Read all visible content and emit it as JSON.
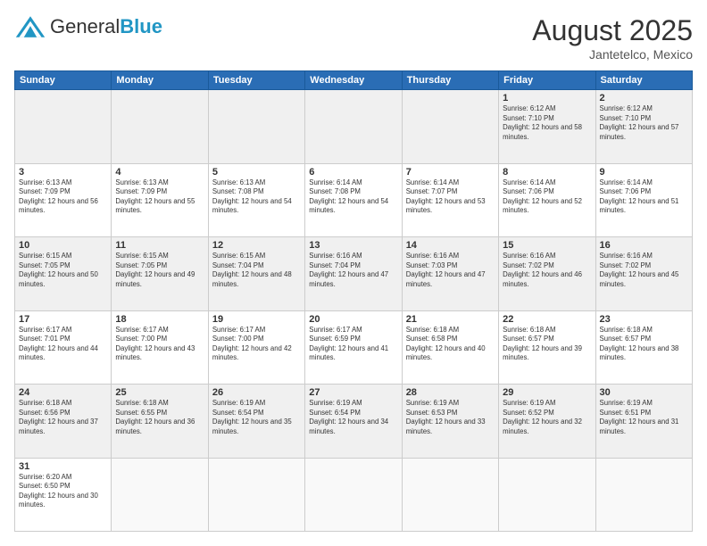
{
  "header": {
    "logo_general": "General",
    "logo_blue": "Blue",
    "month_year": "August 2025",
    "location": "Jantetelco, Mexico"
  },
  "days_of_week": [
    "Sunday",
    "Monday",
    "Tuesday",
    "Wednesday",
    "Thursday",
    "Friday",
    "Saturday"
  ],
  "weeks": [
    [
      {
        "day": "",
        "info": ""
      },
      {
        "day": "",
        "info": ""
      },
      {
        "day": "",
        "info": ""
      },
      {
        "day": "",
        "info": ""
      },
      {
        "day": "",
        "info": ""
      },
      {
        "day": "1",
        "info": "Sunrise: 6:12 AM\nSunset: 7:10 PM\nDaylight: 12 hours and 58 minutes."
      },
      {
        "day": "2",
        "info": "Sunrise: 6:12 AM\nSunset: 7:10 PM\nDaylight: 12 hours and 57 minutes."
      }
    ],
    [
      {
        "day": "3",
        "info": "Sunrise: 6:13 AM\nSunset: 7:09 PM\nDaylight: 12 hours and 56 minutes."
      },
      {
        "day": "4",
        "info": "Sunrise: 6:13 AM\nSunset: 7:09 PM\nDaylight: 12 hours and 55 minutes."
      },
      {
        "day": "5",
        "info": "Sunrise: 6:13 AM\nSunset: 7:08 PM\nDaylight: 12 hours and 54 minutes."
      },
      {
        "day": "6",
        "info": "Sunrise: 6:14 AM\nSunset: 7:08 PM\nDaylight: 12 hours and 54 minutes."
      },
      {
        "day": "7",
        "info": "Sunrise: 6:14 AM\nSunset: 7:07 PM\nDaylight: 12 hours and 53 minutes."
      },
      {
        "day": "8",
        "info": "Sunrise: 6:14 AM\nSunset: 7:06 PM\nDaylight: 12 hours and 52 minutes."
      },
      {
        "day": "9",
        "info": "Sunrise: 6:14 AM\nSunset: 7:06 PM\nDaylight: 12 hours and 51 minutes."
      }
    ],
    [
      {
        "day": "10",
        "info": "Sunrise: 6:15 AM\nSunset: 7:05 PM\nDaylight: 12 hours and 50 minutes."
      },
      {
        "day": "11",
        "info": "Sunrise: 6:15 AM\nSunset: 7:05 PM\nDaylight: 12 hours and 49 minutes."
      },
      {
        "day": "12",
        "info": "Sunrise: 6:15 AM\nSunset: 7:04 PM\nDaylight: 12 hours and 48 minutes."
      },
      {
        "day": "13",
        "info": "Sunrise: 6:16 AM\nSunset: 7:04 PM\nDaylight: 12 hours and 47 minutes."
      },
      {
        "day": "14",
        "info": "Sunrise: 6:16 AM\nSunset: 7:03 PM\nDaylight: 12 hours and 47 minutes."
      },
      {
        "day": "15",
        "info": "Sunrise: 6:16 AM\nSunset: 7:02 PM\nDaylight: 12 hours and 46 minutes."
      },
      {
        "day": "16",
        "info": "Sunrise: 6:16 AM\nSunset: 7:02 PM\nDaylight: 12 hours and 45 minutes."
      }
    ],
    [
      {
        "day": "17",
        "info": "Sunrise: 6:17 AM\nSunset: 7:01 PM\nDaylight: 12 hours and 44 minutes."
      },
      {
        "day": "18",
        "info": "Sunrise: 6:17 AM\nSunset: 7:00 PM\nDaylight: 12 hours and 43 minutes."
      },
      {
        "day": "19",
        "info": "Sunrise: 6:17 AM\nSunset: 7:00 PM\nDaylight: 12 hours and 42 minutes."
      },
      {
        "day": "20",
        "info": "Sunrise: 6:17 AM\nSunset: 6:59 PM\nDaylight: 12 hours and 41 minutes."
      },
      {
        "day": "21",
        "info": "Sunrise: 6:18 AM\nSunset: 6:58 PM\nDaylight: 12 hours and 40 minutes."
      },
      {
        "day": "22",
        "info": "Sunrise: 6:18 AM\nSunset: 6:57 PM\nDaylight: 12 hours and 39 minutes."
      },
      {
        "day": "23",
        "info": "Sunrise: 6:18 AM\nSunset: 6:57 PM\nDaylight: 12 hours and 38 minutes."
      }
    ],
    [
      {
        "day": "24",
        "info": "Sunrise: 6:18 AM\nSunset: 6:56 PM\nDaylight: 12 hours and 37 minutes."
      },
      {
        "day": "25",
        "info": "Sunrise: 6:18 AM\nSunset: 6:55 PM\nDaylight: 12 hours and 36 minutes."
      },
      {
        "day": "26",
        "info": "Sunrise: 6:19 AM\nSunset: 6:54 PM\nDaylight: 12 hours and 35 minutes."
      },
      {
        "day": "27",
        "info": "Sunrise: 6:19 AM\nSunset: 6:54 PM\nDaylight: 12 hours and 34 minutes."
      },
      {
        "day": "28",
        "info": "Sunrise: 6:19 AM\nSunset: 6:53 PM\nDaylight: 12 hours and 33 minutes."
      },
      {
        "day": "29",
        "info": "Sunrise: 6:19 AM\nSunset: 6:52 PM\nDaylight: 12 hours and 32 minutes."
      },
      {
        "day": "30",
        "info": "Sunrise: 6:19 AM\nSunset: 6:51 PM\nDaylight: 12 hours and 31 minutes."
      }
    ],
    [
      {
        "day": "31",
        "info": "Sunrise: 6:20 AM\nSunset: 6:50 PM\nDaylight: 12 hours and 30 minutes."
      },
      {
        "day": "",
        "info": ""
      },
      {
        "day": "",
        "info": ""
      },
      {
        "day": "",
        "info": ""
      },
      {
        "day": "",
        "info": ""
      },
      {
        "day": "",
        "info": ""
      },
      {
        "day": "",
        "info": ""
      }
    ]
  ]
}
